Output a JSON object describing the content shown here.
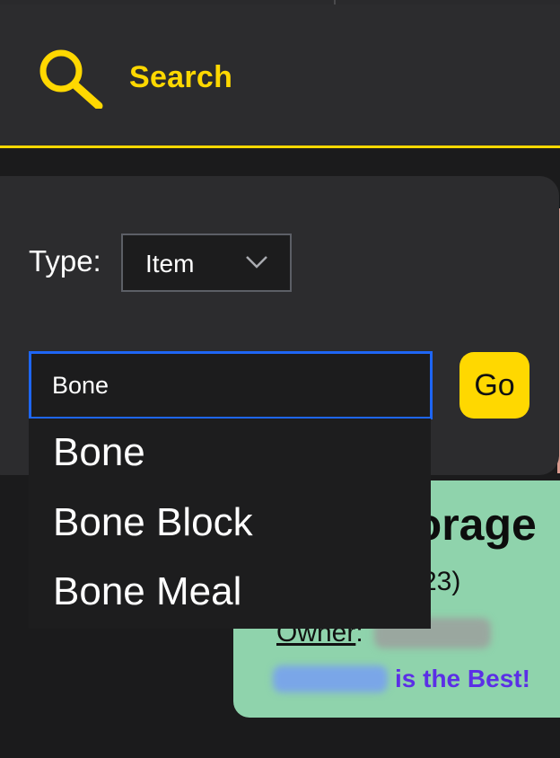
{
  "header": {
    "search_label": "Search",
    "icon": "search-icon",
    "accent_color": "#ffd800"
  },
  "search_panel": {
    "type_label": "Type:",
    "type_selected": "Item",
    "query_value": "Bone",
    "go_label": "Go",
    "input_focus_color": "#1e66f5"
  },
  "suggestions": [
    "Bone",
    "Bone Block",
    "Bone Meal"
  ],
  "storage_card": {
    "title_fragment": "torage",
    "id_fragment": "23)",
    "owner_label": "Owner",
    "owner_colon": ":",
    "best_text": "is the Best!",
    "card_color": "#8fd3ac"
  }
}
